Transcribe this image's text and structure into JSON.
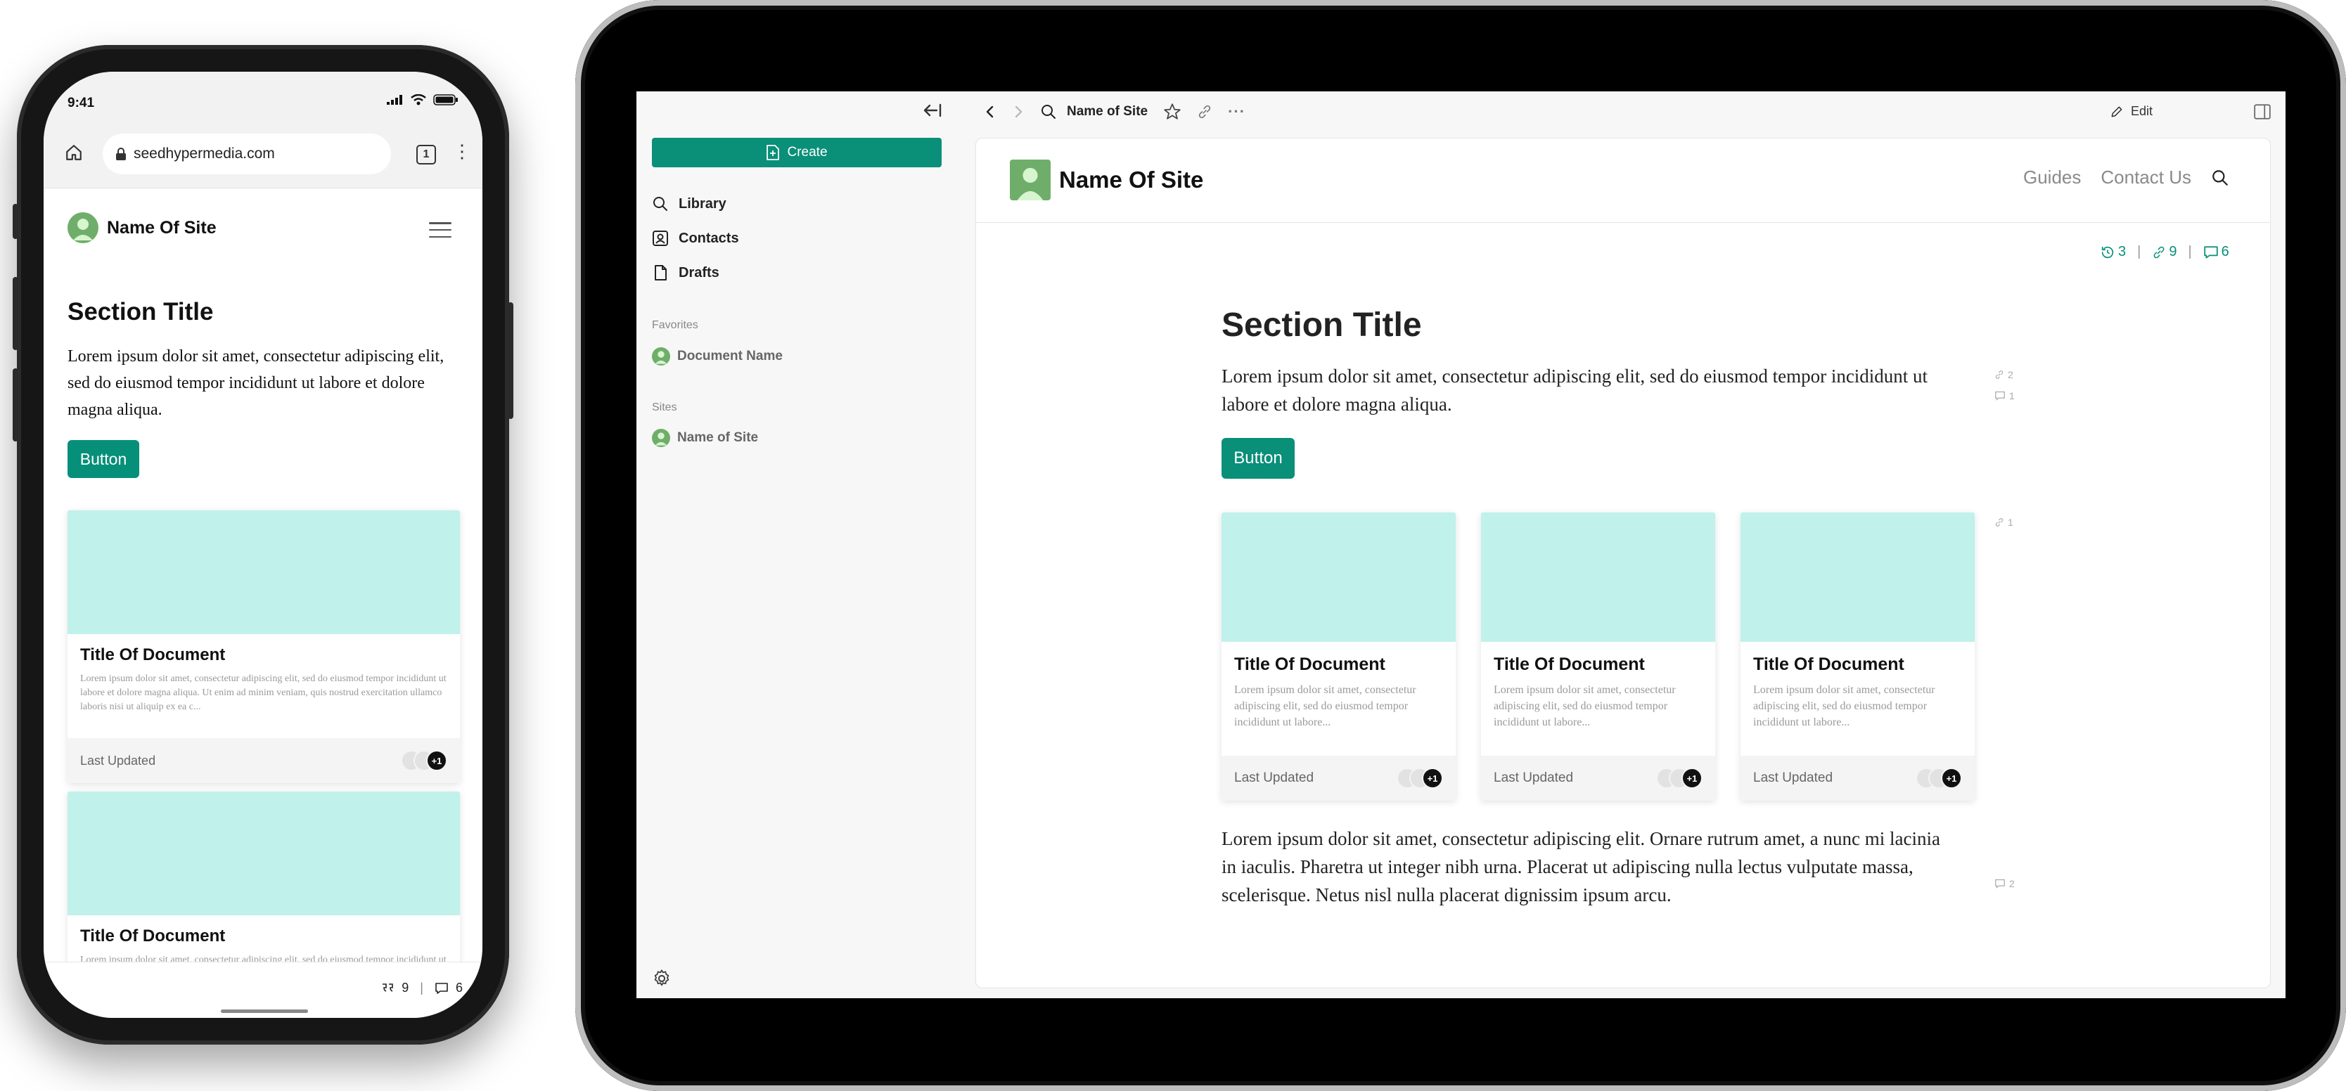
{
  "phone": {
    "status_time": "9:41",
    "url": "seedhypermedia.com",
    "tab_count": "1",
    "site_name": "Name Of Site",
    "section_title": "Section Title",
    "paragraph": "Lorem ipsum dolor sit amet, consectetur adipiscing elit, sed do eiusmod tempor incididunt ut labore et dolore magna aliqua.",
    "button_label": "Button",
    "cards": [
      {
        "title": "Title Of Document",
        "excerpt": "Lorem ipsum dolor sit amet, consectetur adipiscing elit, sed do eiusmod tempor incididunt ut labore et dolore magna aliqua. Ut enim ad minim veniam, quis nostrud exercitation ullamco laboris nisi ut aliquip ex ea c...",
        "footer": "Last Updated",
        "avatar_more": "+1"
      },
      {
        "title": "Title Of Document",
        "excerpt": "Lorem ipsum dolor sit amet, consectetur adipiscing elit, sed do eiusmod tempor incididunt ut labore et dolore magna aliqua. Ut enim ad minim veniam, quis nostrud exercitation ullamco laboris nisi ut aliquip ex ea c..."
      }
    ],
    "bottom_citations": "9",
    "bottom_comments": "6"
  },
  "tablet": {
    "sidebar": {
      "create_label": "Create",
      "nav": [
        {
          "label": "Library",
          "icon": "search-icon"
        },
        {
          "label": "Contacts",
          "icon": "contact-icon"
        },
        {
          "label": "Drafts",
          "icon": "file-icon"
        }
      ],
      "favorites_label": "Favorites",
      "favorite_item": "Document Name",
      "sites_label": "Sites",
      "site_item": "Name of Site"
    },
    "topbar": {
      "title": "Name of Site",
      "edit_label": "Edit"
    },
    "site": {
      "name": "Name Of Site",
      "nav": [
        "Guides",
        "Contact Us"
      ]
    },
    "stats": {
      "versions": "3",
      "citations": "9",
      "comments": "6"
    },
    "section_title": "Section Title",
    "paragraph": "Lorem ipsum dolor sit amet, consectetur adipiscing elit, sed do eiusmod tempor incididunt ut labore et dolore magna aliqua.",
    "button_label": "Button",
    "cards": [
      {
        "title": "Title Of Document",
        "excerpt": "Lorem ipsum dolor sit amet, consectetur adipiscing elit, sed do eiusmod tempor incididunt ut labore...",
        "footer": "Last Updated",
        "avatar_more": "+1"
      },
      {
        "title": "Title Of Document",
        "excerpt": "Lorem ipsum dolor sit amet, consectetur adipiscing elit, sed do eiusmod tempor incididunt ut labore...",
        "footer": "Last Updated",
        "avatar_more": "+1"
      },
      {
        "title": "Title Of Document",
        "excerpt": "Lorem ipsum dolor sit amet, consectetur adipiscing elit, sed do eiusmod tempor incididunt ut labore...",
        "footer": "Last Updated",
        "avatar_more": "+1"
      }
    ],
    "paragraph2": "Lorem ipsum dolor sit amet, consectetur adipiscing elit. Ornare rutrum amet, a nunc mi lacinia in iaculis. Pharetra ut integer nibh urna. Placerat ut adipiscing nulla lectus vulputate massa, scelerisque. Netus nisl nulla placerat dignissim ipsum arcu.",
    "margin_notes": {
      "para1_links": "2",
      "para1_comments": "1",
      "cards_links": "1",
      "para2_comments": "2"
    }
  },
  "colors": {
    "accent": "#0a8f79",
    "card_placeholder": "#c0f1eb"
  }
}
